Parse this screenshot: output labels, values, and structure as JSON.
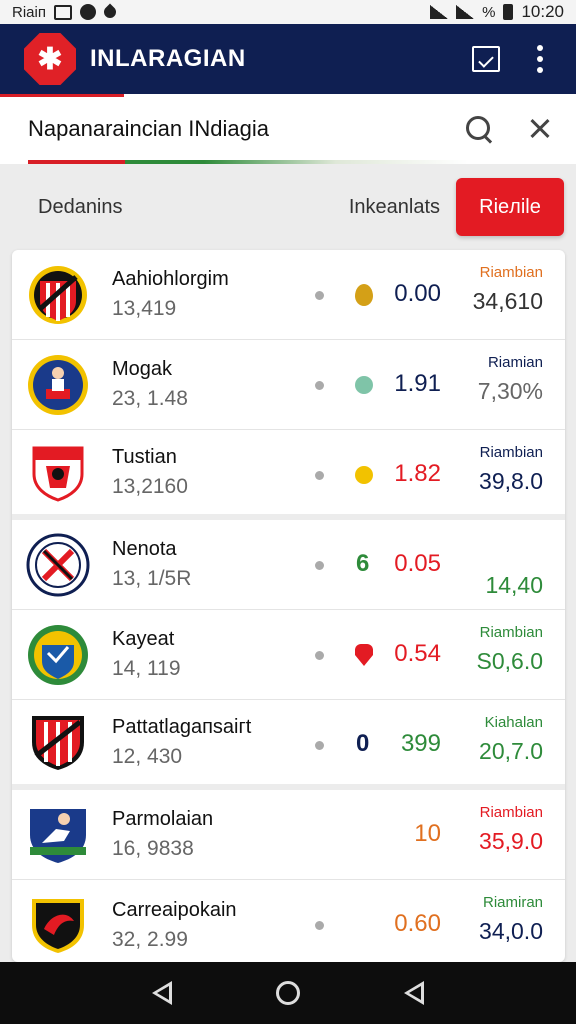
{
  "status_bar": {
    "carrier": "Riaiп",
    "battery": "%",
    "time": "10:20"
  },
  "app_bar": {
    "logo_glyph": "✱",
    "title": "INLARAGIAN"
  },
  "search": {
    "value": "Napanaraincian INdiagia"
  },
  "filters": {
    "left_label": "Dedanins",
    "mid_label": "Inkeanlats",
    "button_label": "Rieлile"
  },
  "rows": [
    {
      "name": "Aahiohlorgim",
      "sub": "13,419",
      "marker": "drop",
      "marker_color": "#d4a017",
      "value": "0.00",
      "value_color": "#0f1f52",
      "tag": "Riambian",
      "tag_color": "#e07020",
      "stat": "34,610",
      "stat_color": "#333333"
    },
    {
      "name": "Mogak",
      "sub": "23, 1.48",
      "marker": "circle",
      "marker_color": "#7fc4a8",
      "value": "1.91",
      "value_color": "#0f1f52",
      "tag": "Riamian",
      "tag_color": "#0f1f52",
      "stat": "7,30%",
      "stat_color": "#666666"
    },
    {
      "name": "Tustian",
      "sub": "13,2160",
      "marker": "circle",
      "marker_color": "#f2c200",
      "value": "1.82",
      "value_color": "#e31b23",
      "tag": "Riambian",
      "tag_color": "#0f1f52",
      "stat": "39,8.0",
      "stat_color": "#0f1f52"
    },
    {
      "name": "Nenota",
      "sub": "13, 1/5R",
      "marker": "text",
      "marker_text": "6",
      "marker_color": "#2e8b3a",
      "value": "0.05",
      "value_color": "#e31b23",
      "tag": "",
      "tag_color": "#2e8b3a",
      "stat": "14,40",
      "stat_color": "#2e8b3a"
    },
    {
      "name": "Kayeat",
      "sub": "14, 119",
      "marker": "pin",
      "marker_color": "#e31b23",
      "value": "0.54",
      "value_color": "#e31b23",
      "tag": "Riambian",
      "tag_color": "#2e8b3a",
      "stat": "S0,6.0",
      "stat_color": "#2e8b3a"
    },
    {
      "name": "Pattatlagaпsaiгt",
      "sub": "12, 430",
      "marker": "text",
      "marker_text": "0",
      "marker_color": "#0f1f52",
      "value": "399",
      "value_color": "#2e8b3a",
      "tag": "Kiahalan",
      "tag_color": "#2e8b3a",
      "stat": "20,7.0",
      "stat_color": "#2e8b3a"
    },
    {
      "name": "Parmolaian",
      "sub": "16, 9838",
      "marker": "none",
      "marker_color": "",
      "value": "10",
      "value_color": "#e07020",
      "tag": "Riambian",
      "tag_color": "#e31b23",
      "stat": "35,9.0",
      "stat_color": "#e31b23"
    },
    {
      "name": "Carreaipokain",
      "sub": "32, 2.99",
      "marker": "none",
      "marker_color": "",
      "value": "0.60",
      "value_color": "#e07020",
      "tag": "Riamiran",
      "tag_color": "#2e8b3a",
      "stat": "34,0.0",
      "stat_color": "#0f1f52"
    }
  ]
}
